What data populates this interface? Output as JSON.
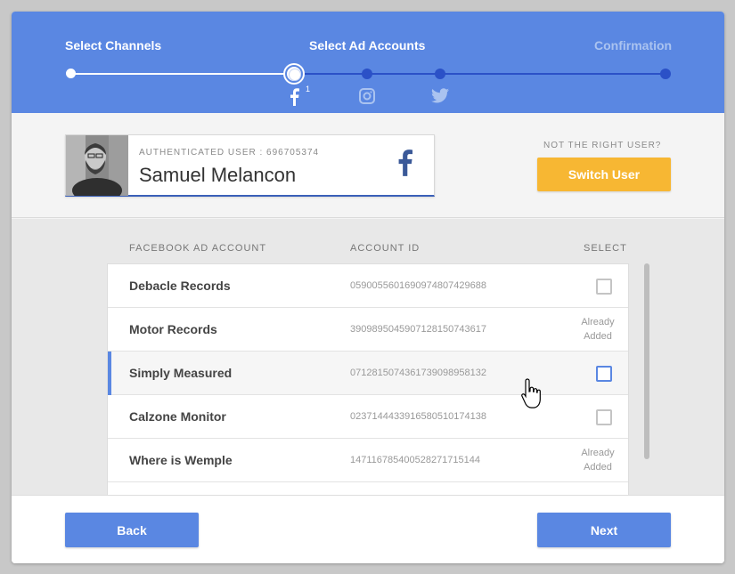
{
  "stepper": {
    "steps": [
      {
        "label": "Select Channels",
        "state": "done"
      },
      {
        "label": "Select Ad Accounts",
        "state": "current"
      },
      {
        "label": "Confirmation",
        "state": "upcoming"
      }
    ],
    "channels": [
      {
        "icon": "facebook-icon",
        "badge": "1"
      },
      {
        "icon": "instagram-icon",
        "badge": ""
      },
      {
        "icon": "twitter-icon",
        "badge": ""
      }
    ],
    "colors": {
      "header": "#5a87e2",
      "track_upcoming": "#2b51c7"
    }
  },
  "user": {
    "auth_label": "AUTHENTICATED USER : 696705374",
    "name": "Samuel Melancon",
    "network_icon": "facebook-icon",
    "not_right_label": "NOT THE RIGHT USER?",
    "switch_label": "Switch User"
  },
  "accounts": {
    "headers": {
      "name": "FACEBOOK AD ACCOUNT",
      "id": "ACCOUNT ID",
      "select": "SELECT"
    },
    "rows": [
      {
        "name": "Debacle Records",
        "id": "059005560169097480742968​8",
        "status": "checkbox"
      },
      {
        "name": "Motor Records",
        "id": "3909895045907128150743617",
        "status": "added"
      },
      {
        "name": "Simply Measured",
        "id": "0712815074361739098958132",
        "status": "checkbox"
      },
      {
        "name": "Calzone Monitor",
        "id": "0237144433916580510174138",
        "status": "checkbox"
      },
      {
        "name": "Where is Wemple",
        "id": "147116785400528271715144",
        "status": "added"
      }
    ],
    "already_added_label": "Already Added",
    "selected_row": 2
  },
  "footer": {
    "back_label": "Back",
    "next_label": "Next"
  }
}
